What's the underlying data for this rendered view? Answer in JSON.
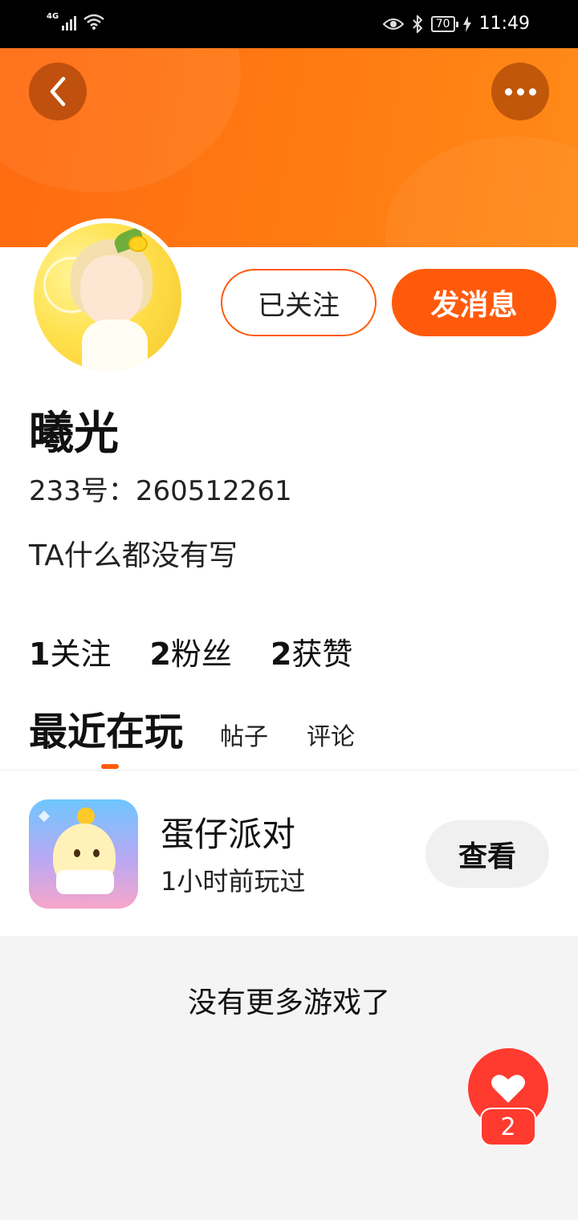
{
  "status_bar": {
    "network": "4G",
    "battery": "70",
    "time": "11:49",
    "icons": [
      "signal-icon",
      "wifi-icon",
      "eye-icon",
      "bluetooth-icon",
      "battery-icon",
      "charging-icon"
    ]
  },
  "header": {
    "back_icon": "chevron-left-icon",
    "more_icon": "more-dots-icon",
    "accent": "#ff5a0c"
  },
  "profile": {
    "name": "曦光",
    "id_text": "233号：260512261",
    "bio": "TA什么都没有写",
    "follow_button": "已关注",
    "message_button": "发消息"
  },
  "stats": [
    {
      "count": "1",
      "label": "关注"
    },
    {
      "count": "2",
      "label": "粉丝"
    },
    {
      "count": "2",
      "label": "获赞"
    }
  ],
  "tabs": {
    "active": "最近在玩",
    "items": [
      "帖子",
      "评论"
    ]
  },
  "recent_games": [
    {
      "name": "蛋仔派对",
      "played": "1小时前玩过",
      "action": "查看"
    }
  ],
  "footer_text": "没有更多游戏了",
  "like_fab": {
    "icon": "heart-icon",
    "count": "2",
    "color": "#ff3a2f"
  }
}
